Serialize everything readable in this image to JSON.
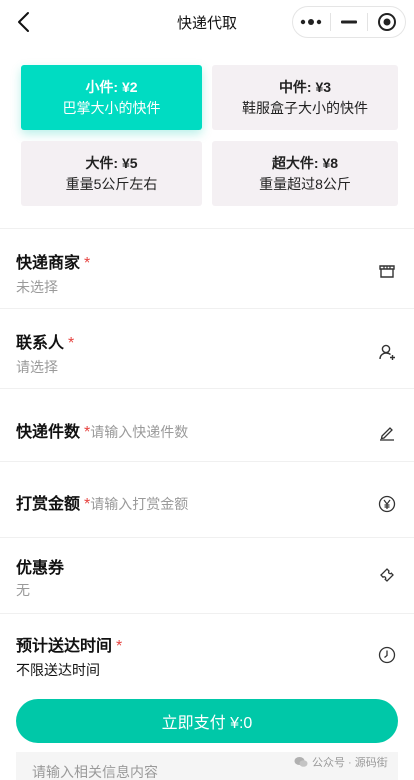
{
  "nav": {
    "title": "快递代取"
  },
  "packages": [
    {
      "title": "小件: ¥2",
      "desc": "巴掌大小的快件",
      "active": true
    },
    {
      "title": "中件: ¥3",
      "desc": "鞋服盒子大小的快件",
      "active": false
    },
    {
      "title": "大件: ¥5",
      "desc": "重量5公斤左右",
      "active": false
    },
    {
      "title": "超大件: ¥8",
      "desc": "重量超过8公斤",
      "active": false
    }
  ],
  "form": {
    "merchant": {
      "label": "快递商家",
      "required": "*",
      "value": "未选择",
      "icon": "store-icon"
    },
    "contact": {
      "label": "联系人",
      "required": "*",
      "value": "请选择",
      "icon": "person-add-icon"
    },
    "count": {
      "label": "快递件数",
      "required": "*",
      "placeholder": "请输入快递件数",
      "icon": "edit-icon"
    },
    "tip": {
      "label": "打赏金额",
      "required": "*",
      "placeholder": "请输入打赏金额",
      "icon": "yen-circle-icon"
    },
    "coupon": {
      "label": "优惠券",
      "value": "无",
      "icon": "ticket-icon"
    },
    "eta": {
      "label": "预计送达时间",
      "required": "*",
      "value": "不限送达时间",
      "icon": "clock-icon"
    }
  },
  "pay": {
    "label": "立即支付 ¥:0"
  },
  "notes": {
    "placeholder": "请输入相关信息内容"
  },
  "watermark": {
    "text": "公众号 · 源码街"
  },
  "colors": {
    "accent": "#00dcc2",
    "pay": "#00c8a8",
    "required": "#e64340",
    "card_bg": "#f4f0f3"
  }
}
